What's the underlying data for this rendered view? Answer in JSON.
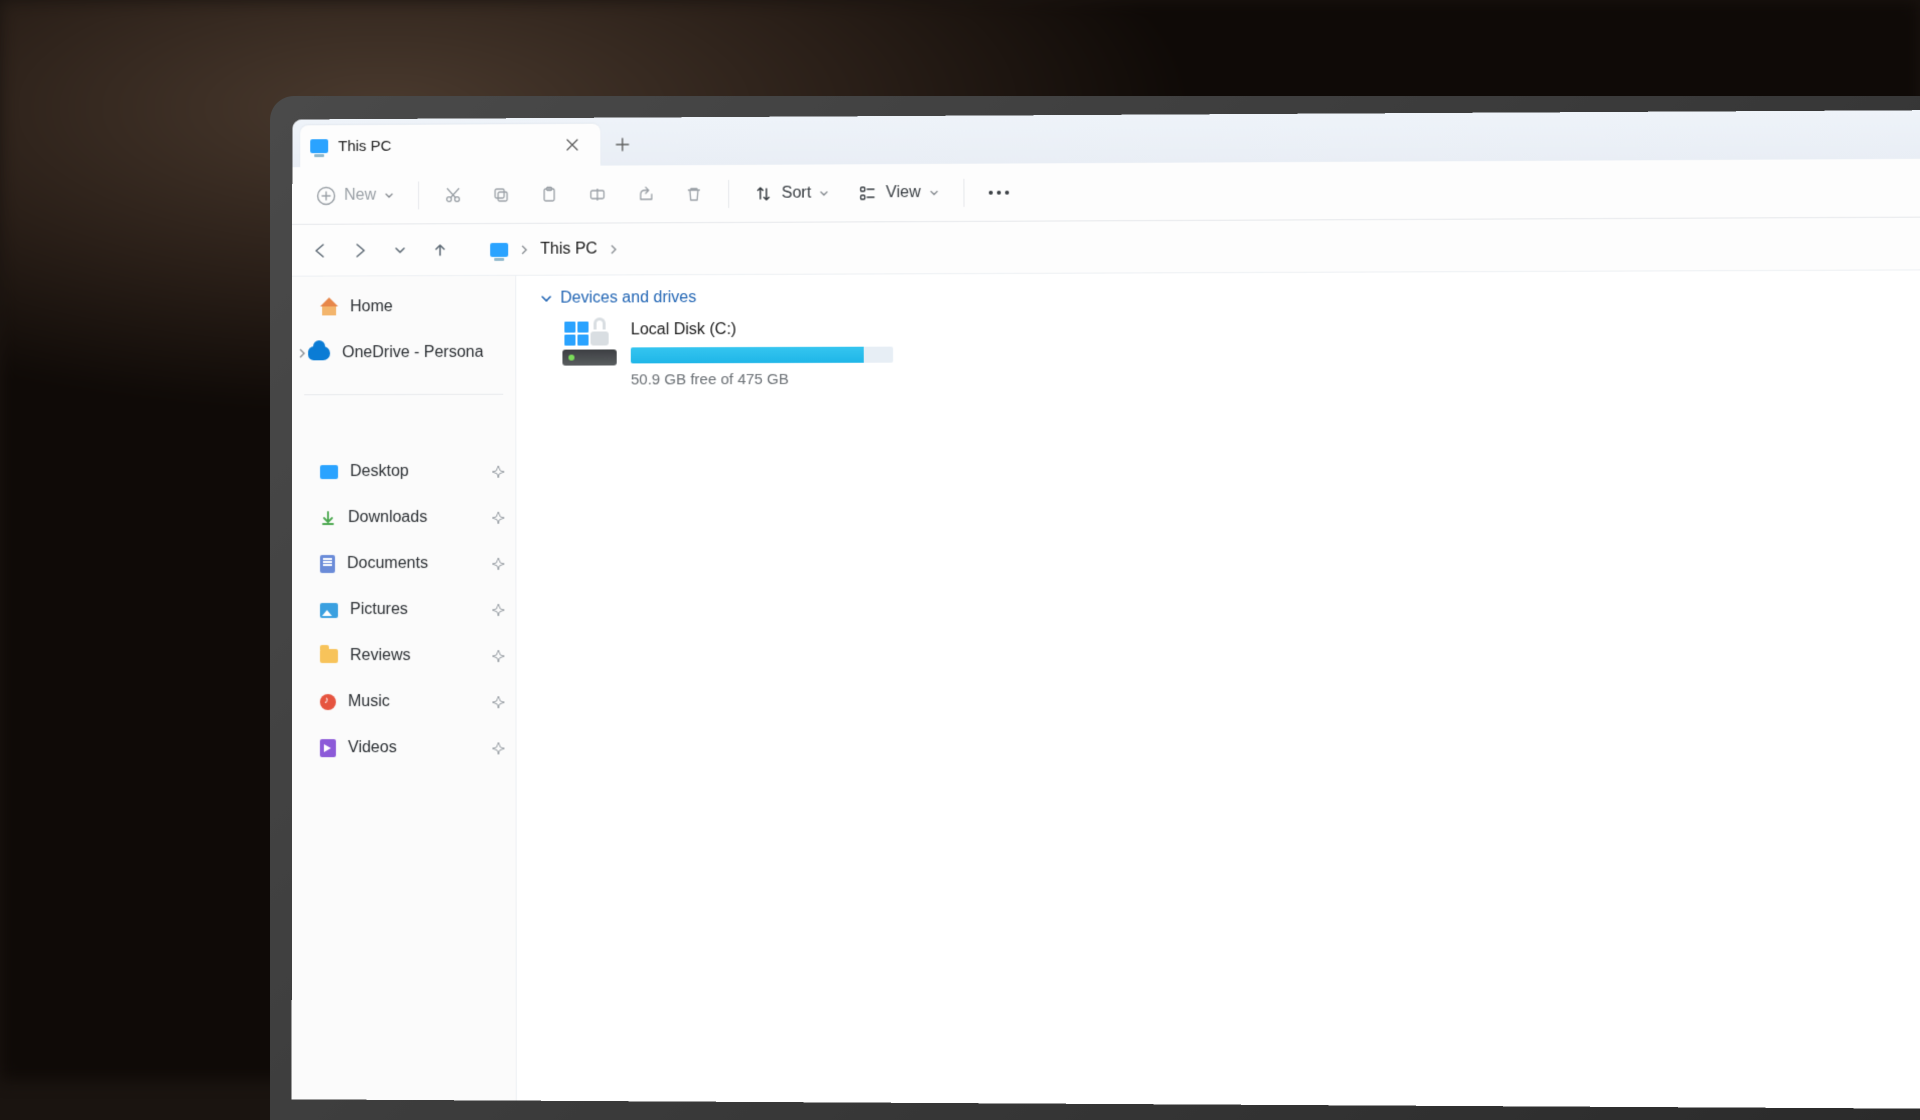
{
  "tab": {
    "title": "This PC"
  },
  "toolbar": {
    "new_label": "New",
    "sort_label": "Sort",
    "view_label": "View"
  },
  "breadcrumb": {
    "location": "This PC"
  },
  "sidebar": {
    "home_label": "Home",
    "onedrive_label": "OneDrive - Persona",
    "quick": [
      {
        "label": "Desktop"
      },
      {
        "label": "Downloads"
      },
      {
        "label": "Documents"
      },
      {
        "label": "Pictures"
      },
      {
        "label": "Reviews"
      },
      {
        "label": "Music"
      },
      {
        "label": "Videos"
      }
    ]
  },
  "content": {
    "section_label": "Devices and drives",
    "drive": {
      "name": "Local Disk (C:)",
      "free_text": "50.9 GB free of 475 GB",
      "used_pct": 89
    }
  }
}
